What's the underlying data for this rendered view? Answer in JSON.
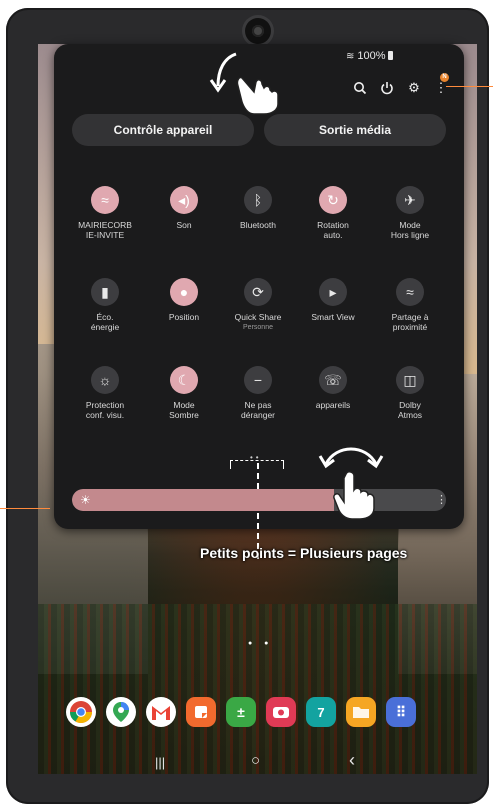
{
  "status": {
    "battery": "100%"
  },
  "quick_panel": {
    "pills": [
      {
        "label": "Contrôle appareil"
      },
      {
        "label": "Sortie média"
      }
    ],
    "notification_badge": "N",
    "tiles": [
      {
        "label": "MAIRIECORB\nIE-INVITE",
        "icon": "wifi-icon",
        "active": true
      },
      {
        "label": "Son",
        "icon": "sound-icon",
        "active": true
      },
      {
        "label": "Bluetooth",
        "icon": "bluetooth-icon",
        "active": false
      },
      {
        "label": "Rotation\nauto.",
        "icon": "rotation-icon",
        "active": true
      },
      {
        "label": "Mode\nHors ligne",
        "icon": "airplane-icon",
        "active": false
      },
      {
        "label": "Éco.\nénergie",
        "icon": "battery-saver-icon",
        "active": false
      },
      {
        "label": "Position",
        "icon": "location-icon",
        "active": true
      },
      {
        "label": "Quick Share",
        "sub": "Personne",
        "icon": "quick-share-icon",
        "active": false
      },
      {
        "label": "Smart View",
        "icon": "smart-view-icon",
        "active": false
      },
      {
        "label": "Partage à\nproximité",
        "icon": "nearby-share-icon",
        "active": false
      },
      {
        "label": "Protection\nconf. visu.",
        "icon": "eye-comfort-icon",
        "active": false
      },
      {
        "label": "Mode\nSombre",
        "icon": "dark-mode-icon",
        "active": true
      },
      {
        "label": "Ne pas\ndéranger",
        "icon": "do-not-disturb-icon",
        "active": false
      },
      {
        "label": "appareils",
        "icon": "devices-icon",
        "active": false
      },
      {
        "label": "Dolby\nAtmos",
        "icon": "dolby-icon",
        "active": false
      }
    ],
    "brightness": 0.7
  },
  "annotation": "Petits points = Plusieurs pages",
  "dock": [
    {
      "name": "chrome-icon",
      "color": "#ffffff"
    },
    {
      "name": "maps-icon",
      "color": "#ffffff"
    },
    {
      "name": "gmail-icon",
      "color": "#ffffff"
    },
    {
      "name": "notes-icon",
      "color": "#f26a2e"
    },
    {
      "name": "calculator-icon",
      "color": "#3aa845",
      "glyph": "±"
    },
    {
      "name": "camera-icon",
      "color": "#e03a55"
    },
    {
      "name": "calendar-icon",
      "color": "#13a3a0",
      "glyph": "7"
    },
    {
      "name": "files-icon",
      "color": "#f5a623"
    },
    {
      "name": "apps-icon",
      "color": "#4a6fd8",
      "glyph": "⠿"
    }
  ],
  "nav": {
    "recents": "|||",
    "home": "○",
    "back": "‹"
  }
}
